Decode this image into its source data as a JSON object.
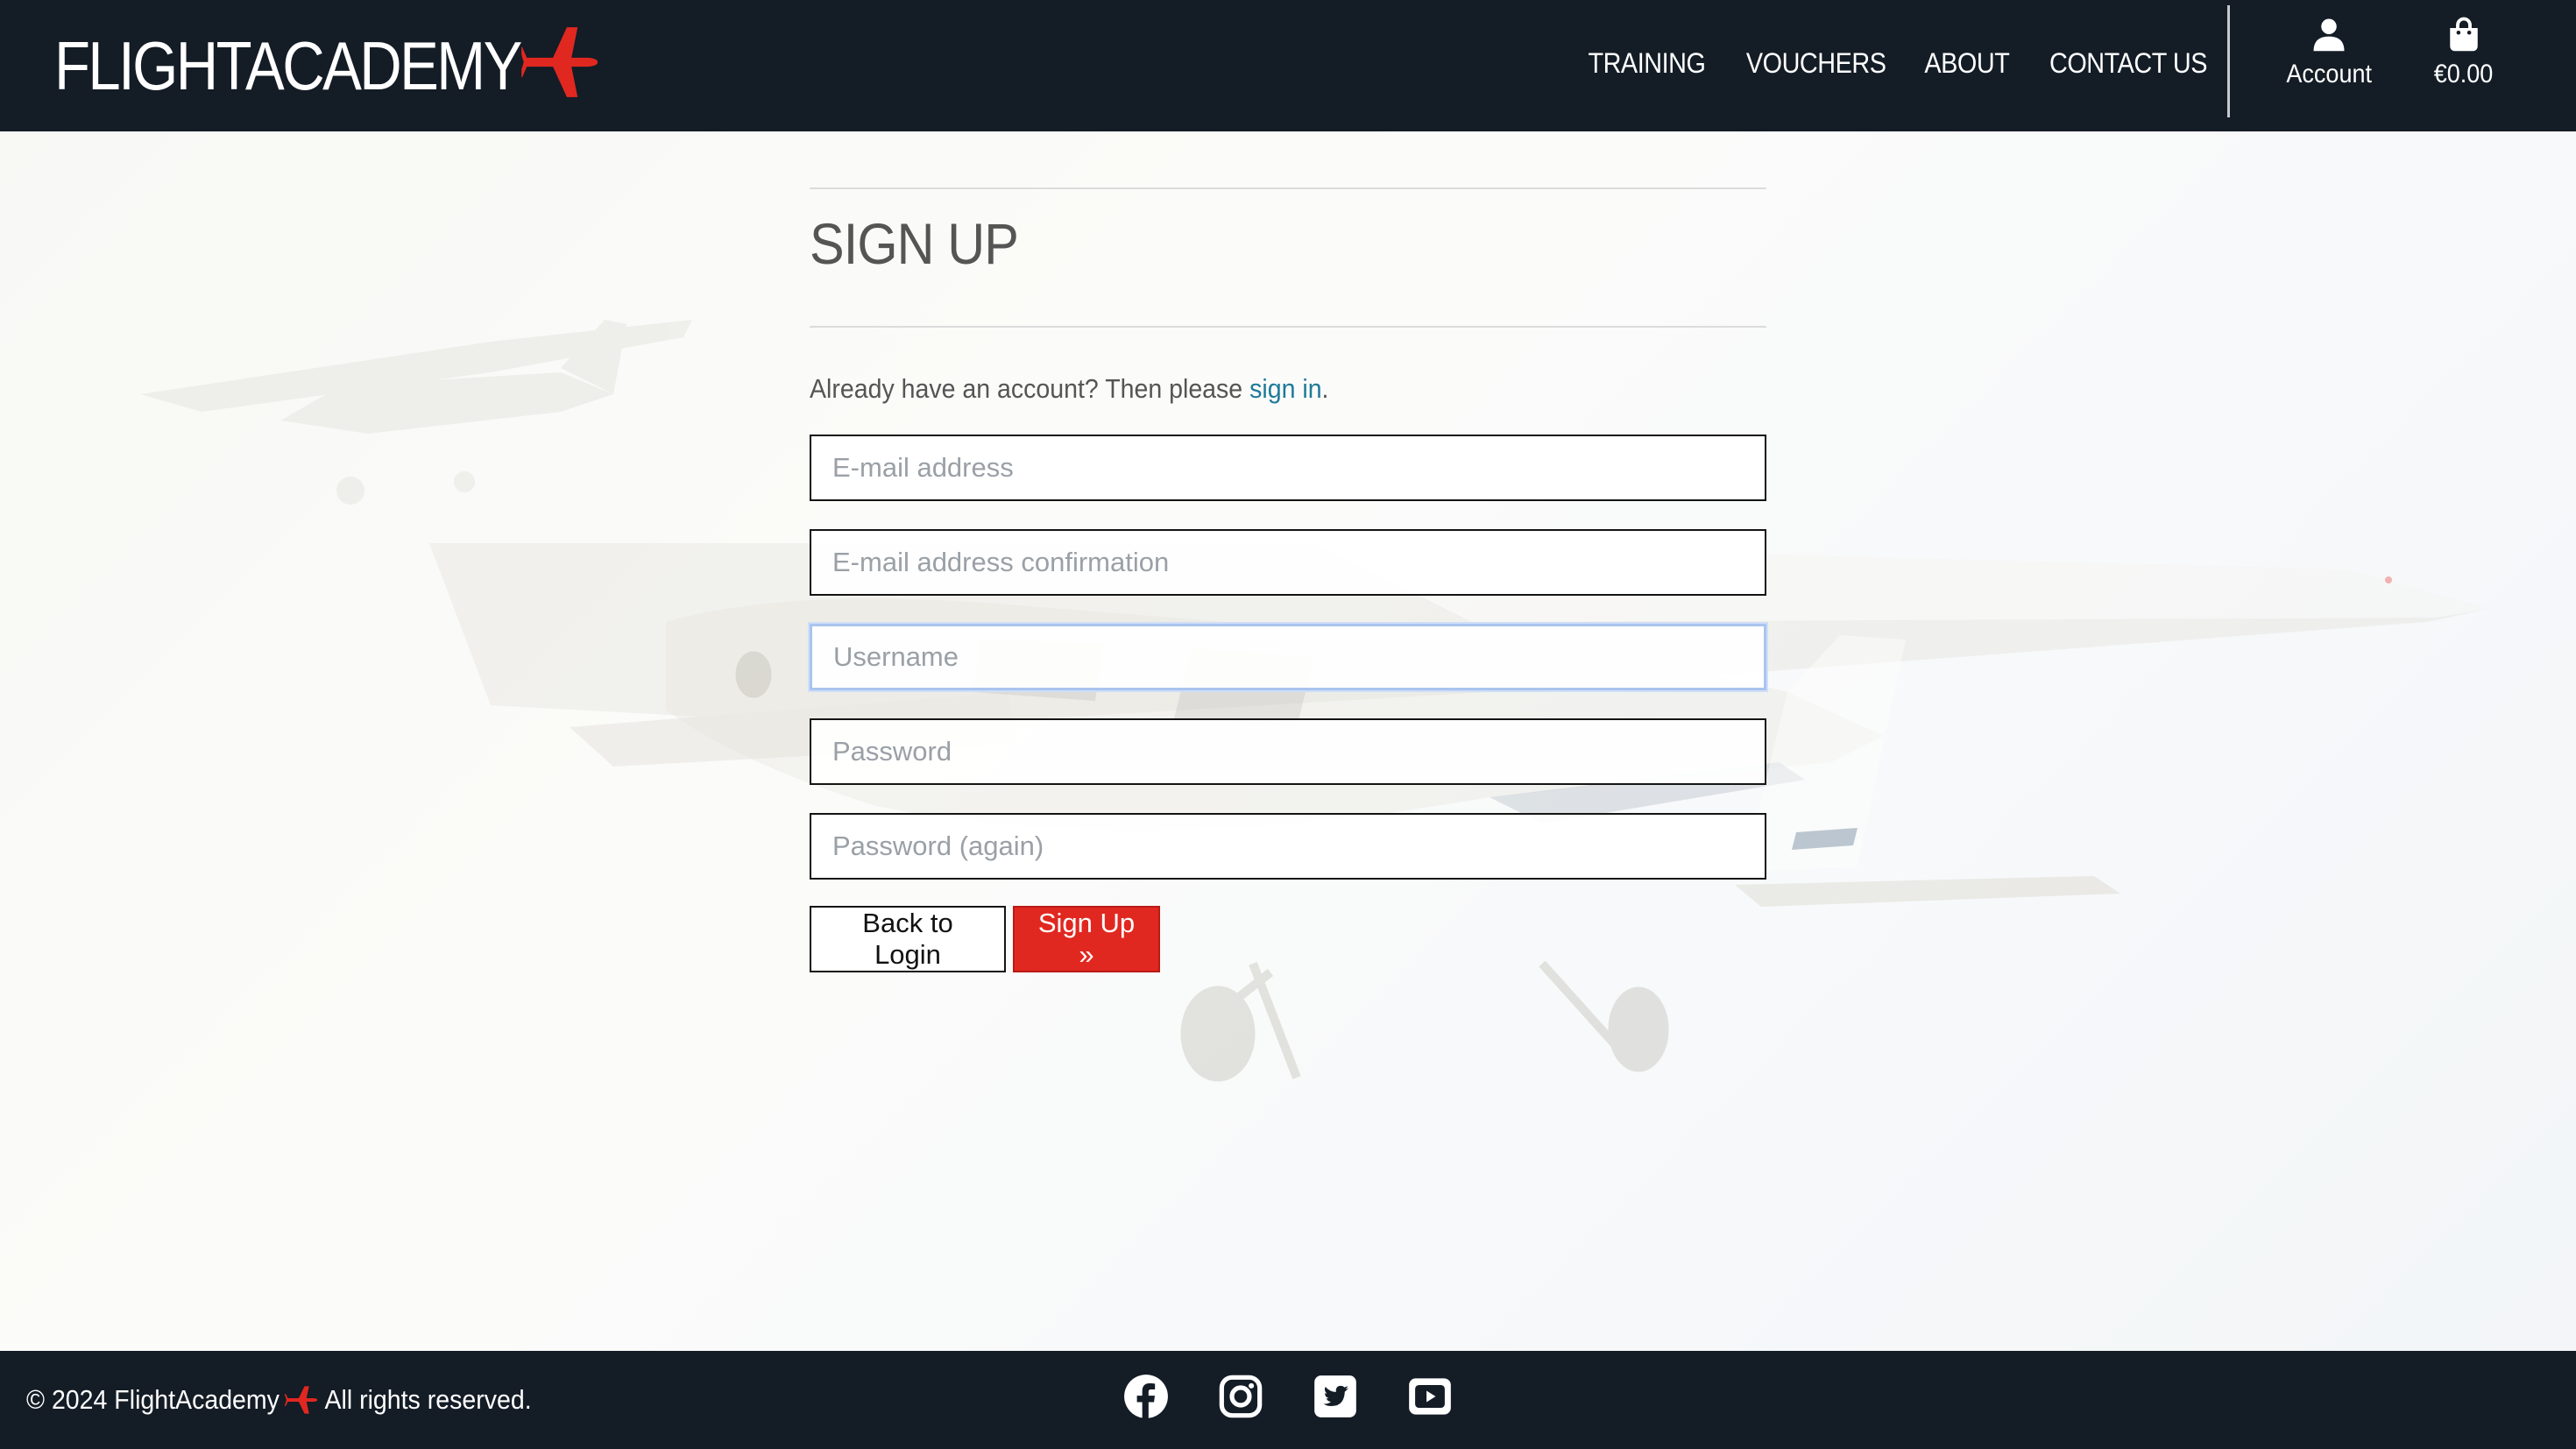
{
  "brand": {
    "name": "FLIGHTACADEMY",
    "accent": "#e02820",
    "header_bg": "#141c26"
  },
  "nav": {
    "links": [
      "TRAINING",
      "VOUCHERS",
      "ABOUT",
      "CONTACT US"
    ],
    "account_label": "Account",
    "cart_total": "€0.00"
  },
  "signup": {
    "title": "SIGN UP",
    "signin_prefix": "Already have an account? Then please",
    "signin_link": "sign in",
    "signin_suffix": ".",
    "fields": {
      "email_placeholder": "E-mail address",
      "email_confirm_placeholder": "E-mail address confirmation",
      "username_placeholder": "Username",
      "password_placeholder": "Password",
      "password_again_placeholder": "Password (again)"
    },
    "focused_field": "Username",
    "back_button": "Back to Login",
    "submit_button": "Sign Up »"
  },
  "footer": {
    "copyright_prefix": "© 2024 FlightAcademy",
    "copyright_suffix": "All rights reserved.",
    "socials": [
      "facebook-icon",
      "instagram-icon",
      "twitter-icon",
      "youtube-icon"
    ]
  }
}
